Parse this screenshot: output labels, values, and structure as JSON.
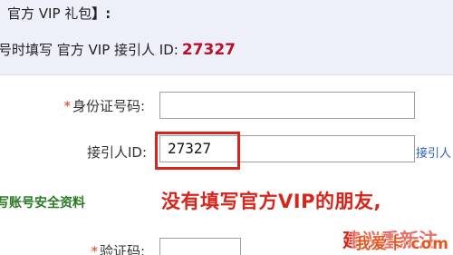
{
  "gift": {
    "title": "官方 VIP 礼包",
    "bracket": "】:"
  },
  "referrer_line": {
    "text": "号时填写 官方 VIP 接引人 ID:",
    "id_value": "27327"
  },
  "form": {
    "idcard": {
      "required_mark": "*",
      "label": "身份证号码:",
      "value": ""
    },
    "referrer": {
      "label": "接引人ID:",
      "value": "27327",
      "hint": "接引人"
    },
    "captcha": {
      "required_mark": "*",
      "label": "验证码:",
      "value": ""
    }
  },
  "section": {
    "title": "写账号安全资料"
  },
  "notice": {
    "line1": "没有填写官方VIP的朋友,",
    "line2": "建议重新注"
  },
  "watermark": {
    "text": "我爱卡·com"
  },
  "colors": {
    "accent_red": "#d9241b",
    "id_red": "#b8102a",
    "section_green": "#2b7a22",
    "link_blue": "#2a62b8",
    "panel_bg": "#eef0f9"
  }
}
